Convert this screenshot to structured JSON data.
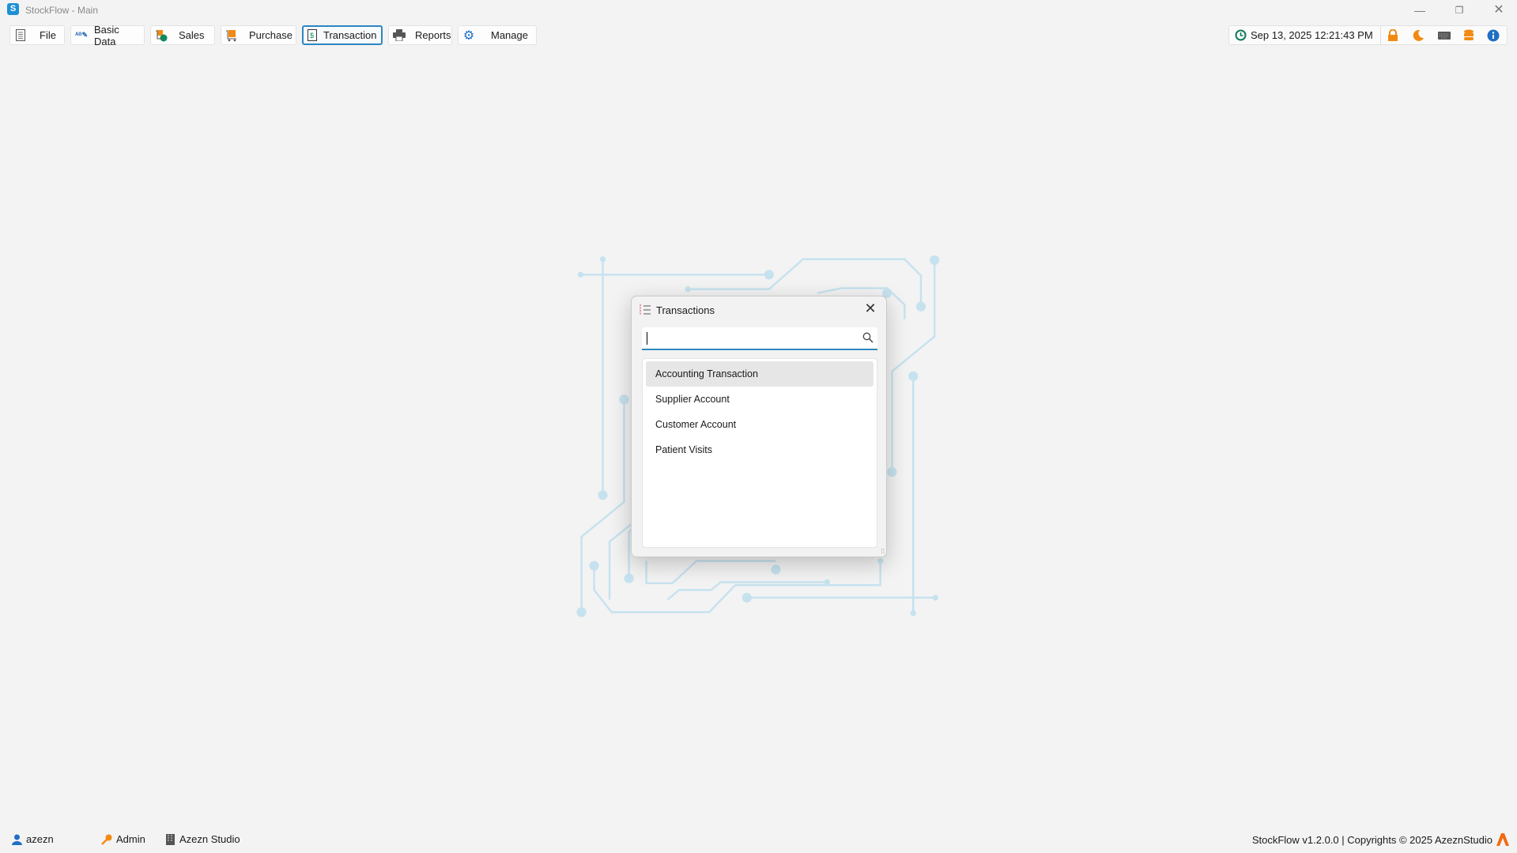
{
  "window": {
    "title": "StockFlow - Main",
    "app_icon_letter": "S"
  },
  "toolbar": [
    {
      "label": "File",
      "icon": "document-icon"
    },
    {
      "label": "Basic Data",
      "icon": "edit-abc-icon"
    },
    {
      "label": "Sales",
      "icon": "sales-icon"
    },
    {
      "label": "Purchase",
      "icon": "cart-icon"
    },
    {
      "label": "Transaction",
      "icon": "dollar-icon",
      "active": true
    },
    {
      "label": "Reports",
      "icon": "printer-icon"
    },
    {
      "label": "Manage",
      "icon": "gear-icon"
    }
  ],
  "status": {
    "datetime": "Sep 13, 2025 12:21:43 PM",
    "icons": [
      "lock-icon",
      "moon-icon",
      "keyboard-icon",
      "database-icon",
      "info-icon"
    ]
  },
  "dialog": {
    "title": "Transactions",
    "search": {
      "value": "",
      "placeholder": ""
    },
    "items": [
      "Accounting Transaction",
      "Supplier Account",
      "Customer Account",
      "Patient Visits"
    ],
    "selected_index": 0
  },
  "footer": {
    "user": "azezn",
    "role": "Admin",
    "company": "Azezn Studio",
    "version_text": "StockFlow v1.2.0.0 | Copyrights © 2025 AzeznStudio"
  },
  "colors": {
    "accent": "#2c86c2",
    "orange": "#f28a12",
    "circuit": "#c6e2ef"
  }
}
